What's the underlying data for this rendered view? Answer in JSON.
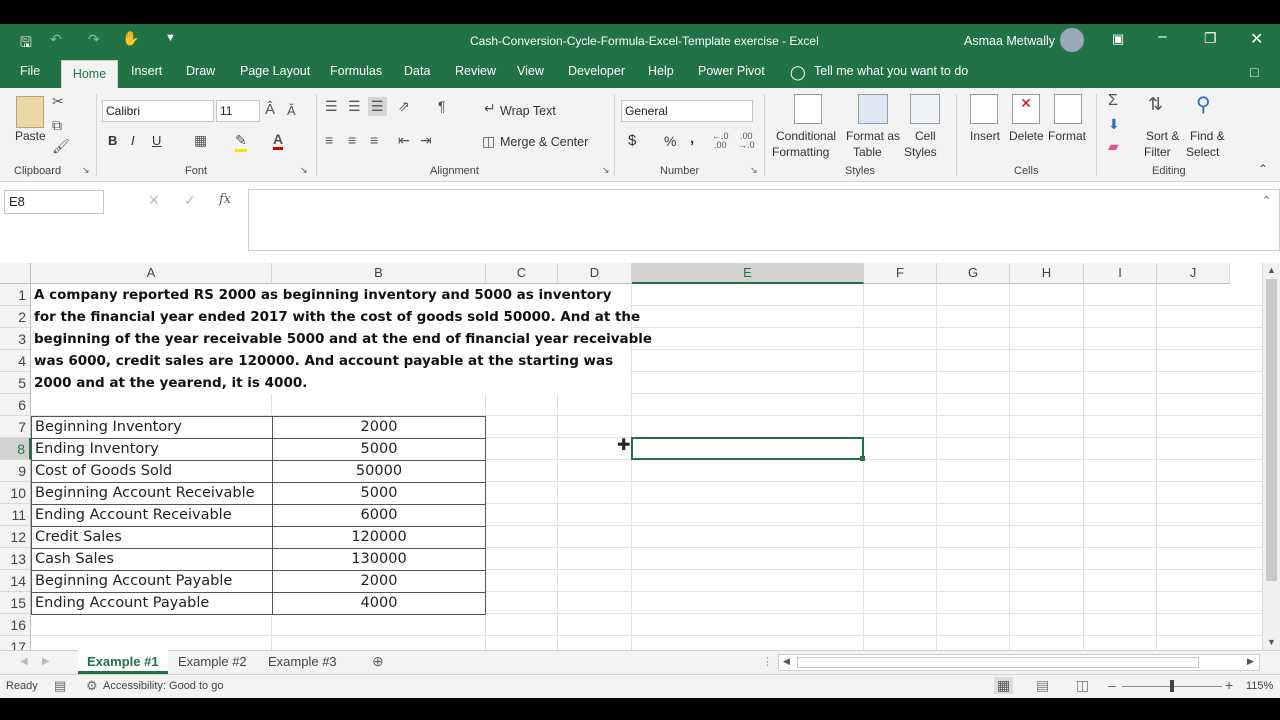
{
  "window": {
    "title": "Cash-Conversion-Cycle-Formula-Excel-Template exercise  -  Excel",
    "user": "Asmaa Metwally"
  },
  "tabs": [
    "File",
    "Home",
    "Insert",
    "Draw",
    "Page Layout",
    "Formulas",
    "Data",
    "Review",
    "View",
    "Developer",
    "Help",
    "Power Pivot"
  ],
  "tell_me": "Tell me what you want to do",
  "ribbon": {
    "clipboard": {
      "paste": "Paste",
      "label": "Clipboard"
    },
    "font": {
      "name": "Calibri",
      "size": "11",
      "bold": "B",
      "italic": "I",
      "underline": "U",
      "label": "Font"
    },
    "alignment": {
      "wrap": "Wrap Text",
      "merge": "Merge & Center",
      "label": "Alignment"
    },
    "number": {
      "format": "General",
      "currency": "$",
      "percent": "%",
      "comma": ",",
      "inc": ".0\n.00",
      "dec": ".00\n.0",
      "label": "Number"
    },
    "styles": {
      "cond1": "Conditional",
      "cond2": "Formatting",
      "fmt1": "Format as",
      "fmt2": "Table",
      "cell1": "Cell",
      "cell2": "Styles",
      "label": "Styles"
    },
    "cells": {
      "insert": "Insert",
      "delete": "Delete",
      "format": "Format",
      "label": "Cells"
    },
    "editing": {
      "sort1": "Sort &",
      "sort2": "Filter",
      "find1": "Find &",
      "find2": "Select",
      "label": "Editing"
    }
  },
  "namebox": "E8",
  "fx": "fx",
  "columns": [
    "A",
    "B",
    "C",
    "D",
    "E",
    "F",
    "G",
    "H",
    "I",
    "J"
  ],
  "rows": [
    "1",
    "2",
    "3",
    "4",
    "5",
    "6",
    "7",
    "8",
    "9",
    "10",
    "11",
    "12",
    "13",
    "14",
    "15",
    "16",
    "17"
  ],
  "paragraph": [
    "A company reported RS 2000 as beginning inventory and 5000 as inventory",
    "for the financial year ended 2017 with the cost of goods sold 50000. And at the",
    "beginning of the year receivable 5000 and at the end of financial year receivable",
    "was 6000, credit sales are 120000. And account payable at the starting was",
    "2000 and at the yearend, it is 4000."
  ],
  "table": [
    {
      "label": "Beginning Inventory",
      "value": "2000"
    },
    {
      "label": "Ending Inventory",
      "value": "5000"
    },
    {
      "label": "Cost of Goods Sold",
      "value": "50000"
    },
    {
      "label": "Beginning Account Receivable",
      "value": "5000"
    },
    {
      "label": "Ending Account Receivable",
      "value": "6000"
    },
    {
      "label": "Credit Sales",
      "value": "120000"
    },
    {
      "label": "Cash Sales",
      "value": "130000"
    },
    {
      "label": "Beginning Account Payable",
      "value": "2000"
    },
    {
      "label": "Ending Account Payable",
      "value": "4000"
    }
  ],
  "sheets": [
    "Example #1",
    "Example #2",
    "Example #3"
  ],
  "status": {
    "ready": "Ready",
    "accessibility": "Accessibility: Good to go",
    "zoom": "115%"
  },
  "colors": {
    "excel_green": "#217346"
  }
}
